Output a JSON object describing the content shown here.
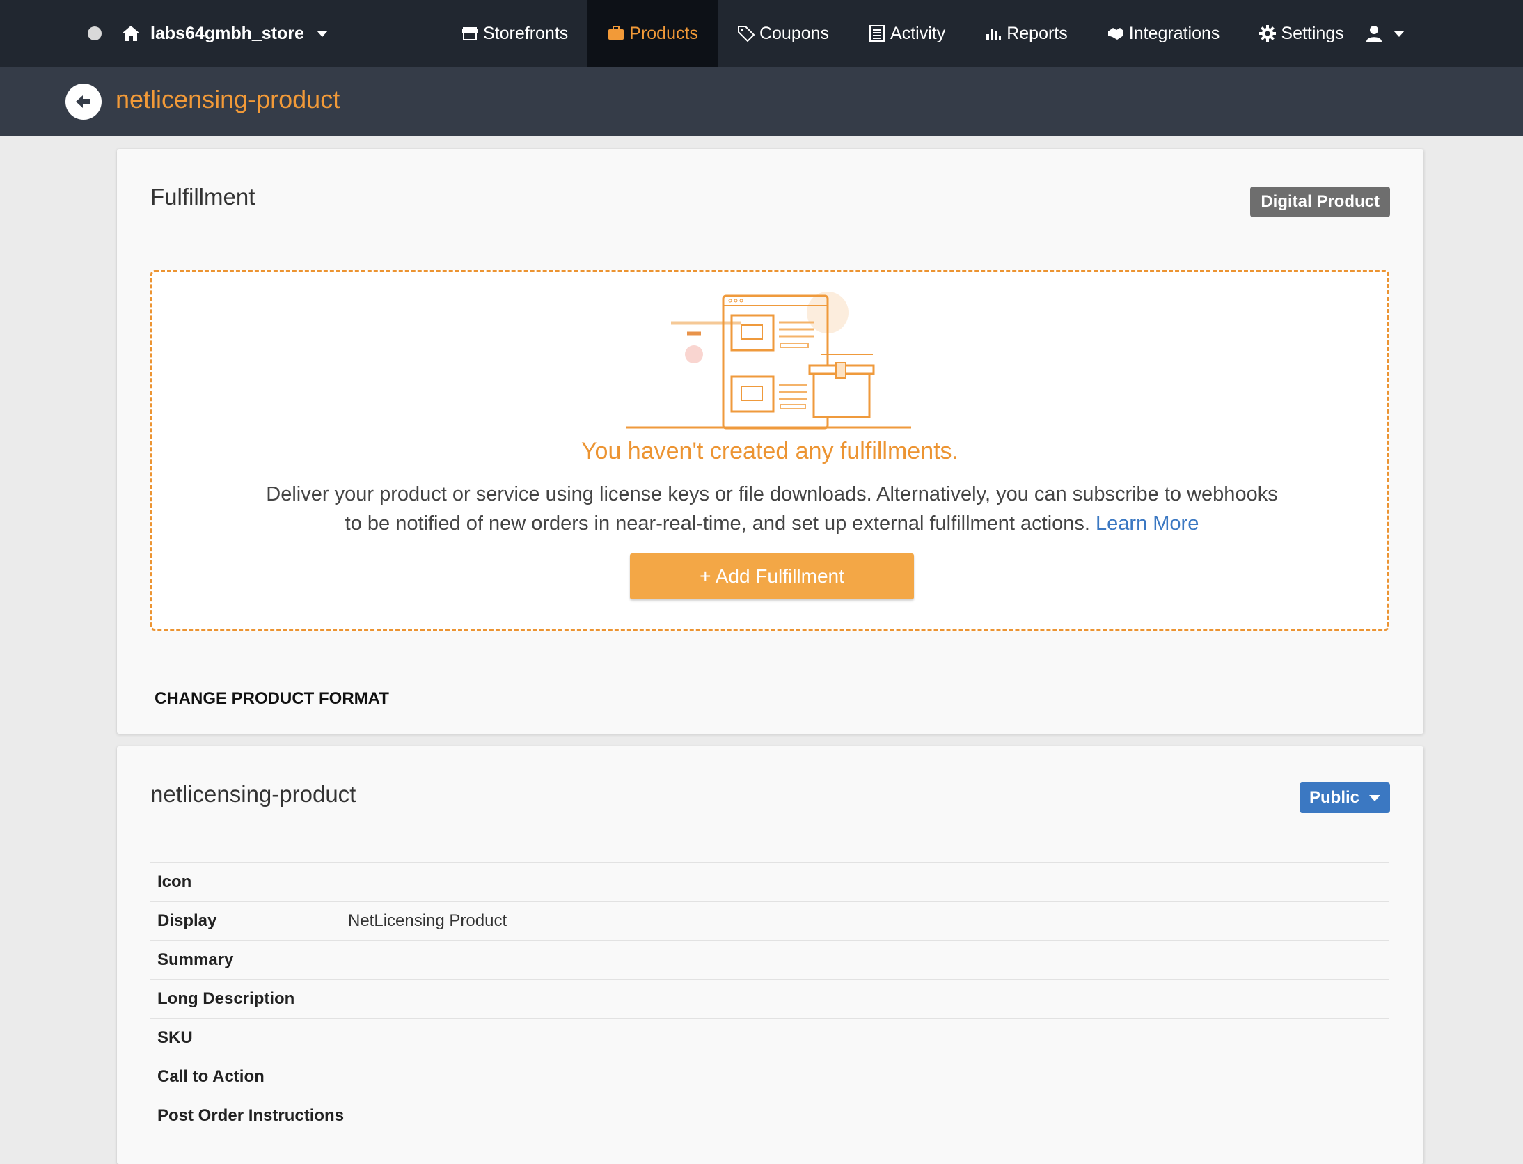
{
  "nav": {
    "store_name": "labs64gmbh_store",
    "items": [
      {
        "label": "Storefronts",
        "icon": "storefront-icon"
      },
      {
        "label": "Products",
        "icon": "briefcase-icon",
        "active": true
      },
      {
        "label": "Coupons",
        "icon": "tags-icon"
      },
      {
        "label": "Activity",
        "icon": "list-icon"
      },
      {
        "label": "Reports",
        "icon": "bar-chart-icon"
      },
      {
        "label": "Integrations",
        "icon": "handshake-icon"
      },
      {
        "label": "Settings",
        "icon": "gear-icon"
      }
    ]
  },
  "header": {
    "title": "netlicensing-product"
  },
  "fulfillment": {
    "title": "Fulfillment",
    "badge": "Digital Product",
    "empty_title": "You haven't created any fulfillments.",
    "empty_desc": "Deliver your product or service using license keys or file downloads. Alternatively, you can subscribe to webhooks to be notified of new orders in near-real-time, and set up external fulfillment actions.",
    "learn_more": "Learn More",
    "add_button": "+ Add Fulfillment",
    "change_format": "CHANGE PRODUCT FORMAT"
  },
  "product": {
    "title": "netlicensing-product",
    "visibility": "Public",
    "rows": [
      {
        "key": "Icon",
        "value": ""
      },
      {
        "key": "Display",
        "value": "NetLicensing Product"
      },
      {
        "key": "Summary",
        "value": ""
      },
      {
        "key": "Long Description",
        "value": ""
      },
      {
        "key": "SKU",
        "value": ""
      },
      {
        "key": "Call to Action",
        "value": ""
      },
      {
        "key": "Post Order Instructions",
        "value": ""
      }
    ]
  },
  "colors": {
    "nav_bg": "#212730",
    "subheader_bg": "#353c48",
    "accent_orange": "#f29a38",
    "link_blue": "#3b78c2"
  }
}
